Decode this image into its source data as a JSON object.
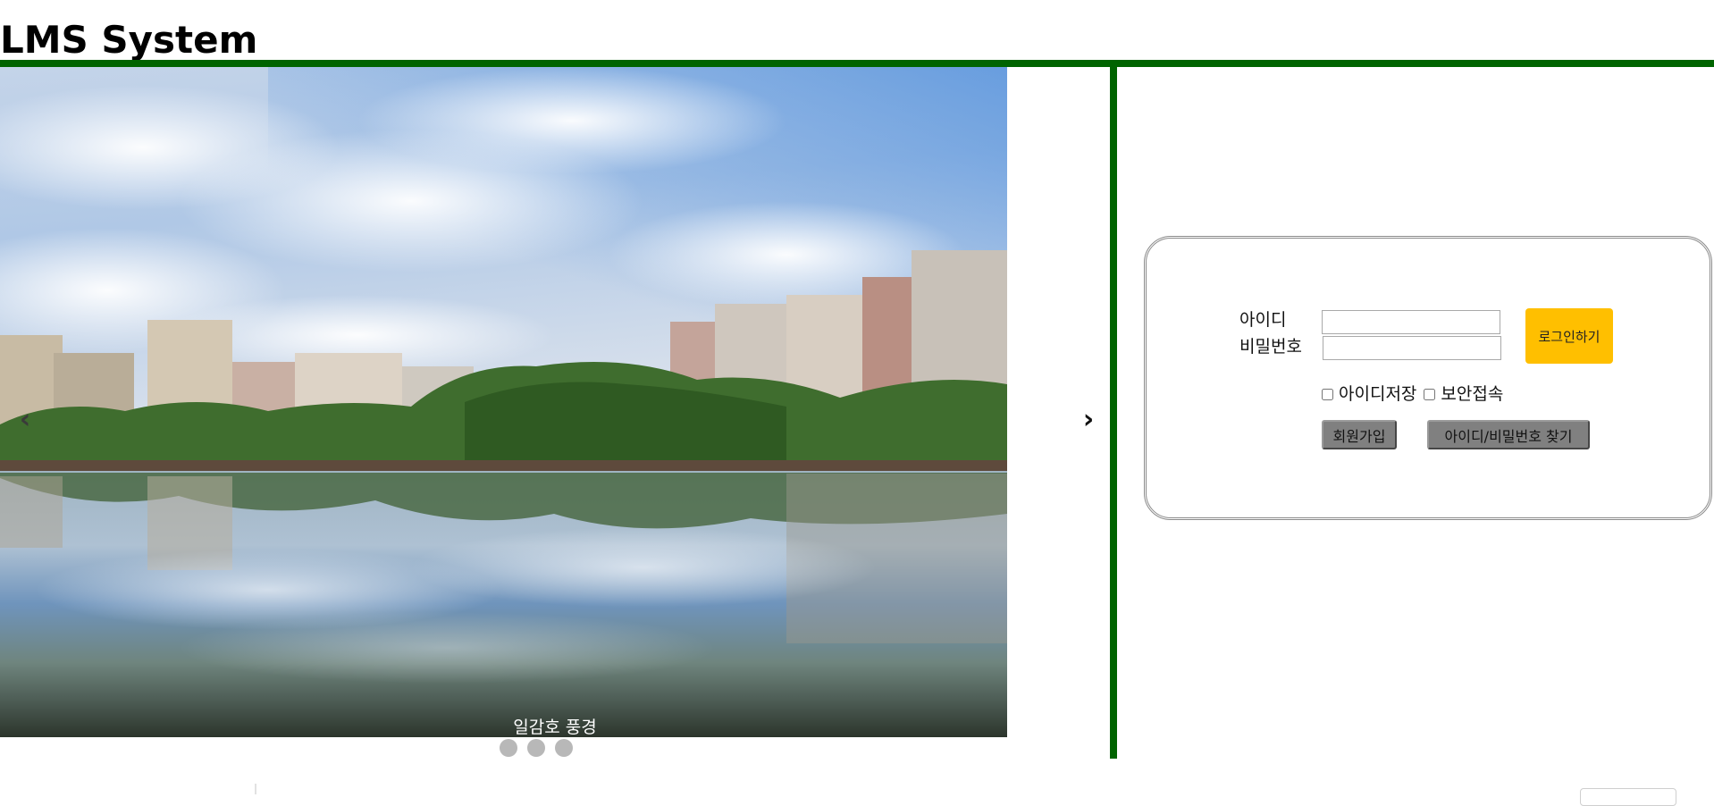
{
  "site": {
    "title": "LMS System",
    "accent_color": "#006400"
  },
  "carousel": {
    "prev_label": "‹",
    "next_label": "›",
    "slide_caption": "일감호 풍경",
    "indicator_count": 3,
    "active_indicator": 0
  },
  "login": {
    "id_label": "아이디",
    "password_label": "비밀번호",
    "id_value": "",
    "password_value": "",
    "login_button": "로그인하기",
    "login_button_color": "#ffbf00",
    "save_id_label": "아이디저장",
    "save_id_checked": false,
    "secure_login_label": "보안접속",
    "secure_login_checked": false,
    "signup_button": "회원가입",
    "find_button": "아이디/비밀번호 찾기"
  }
}
